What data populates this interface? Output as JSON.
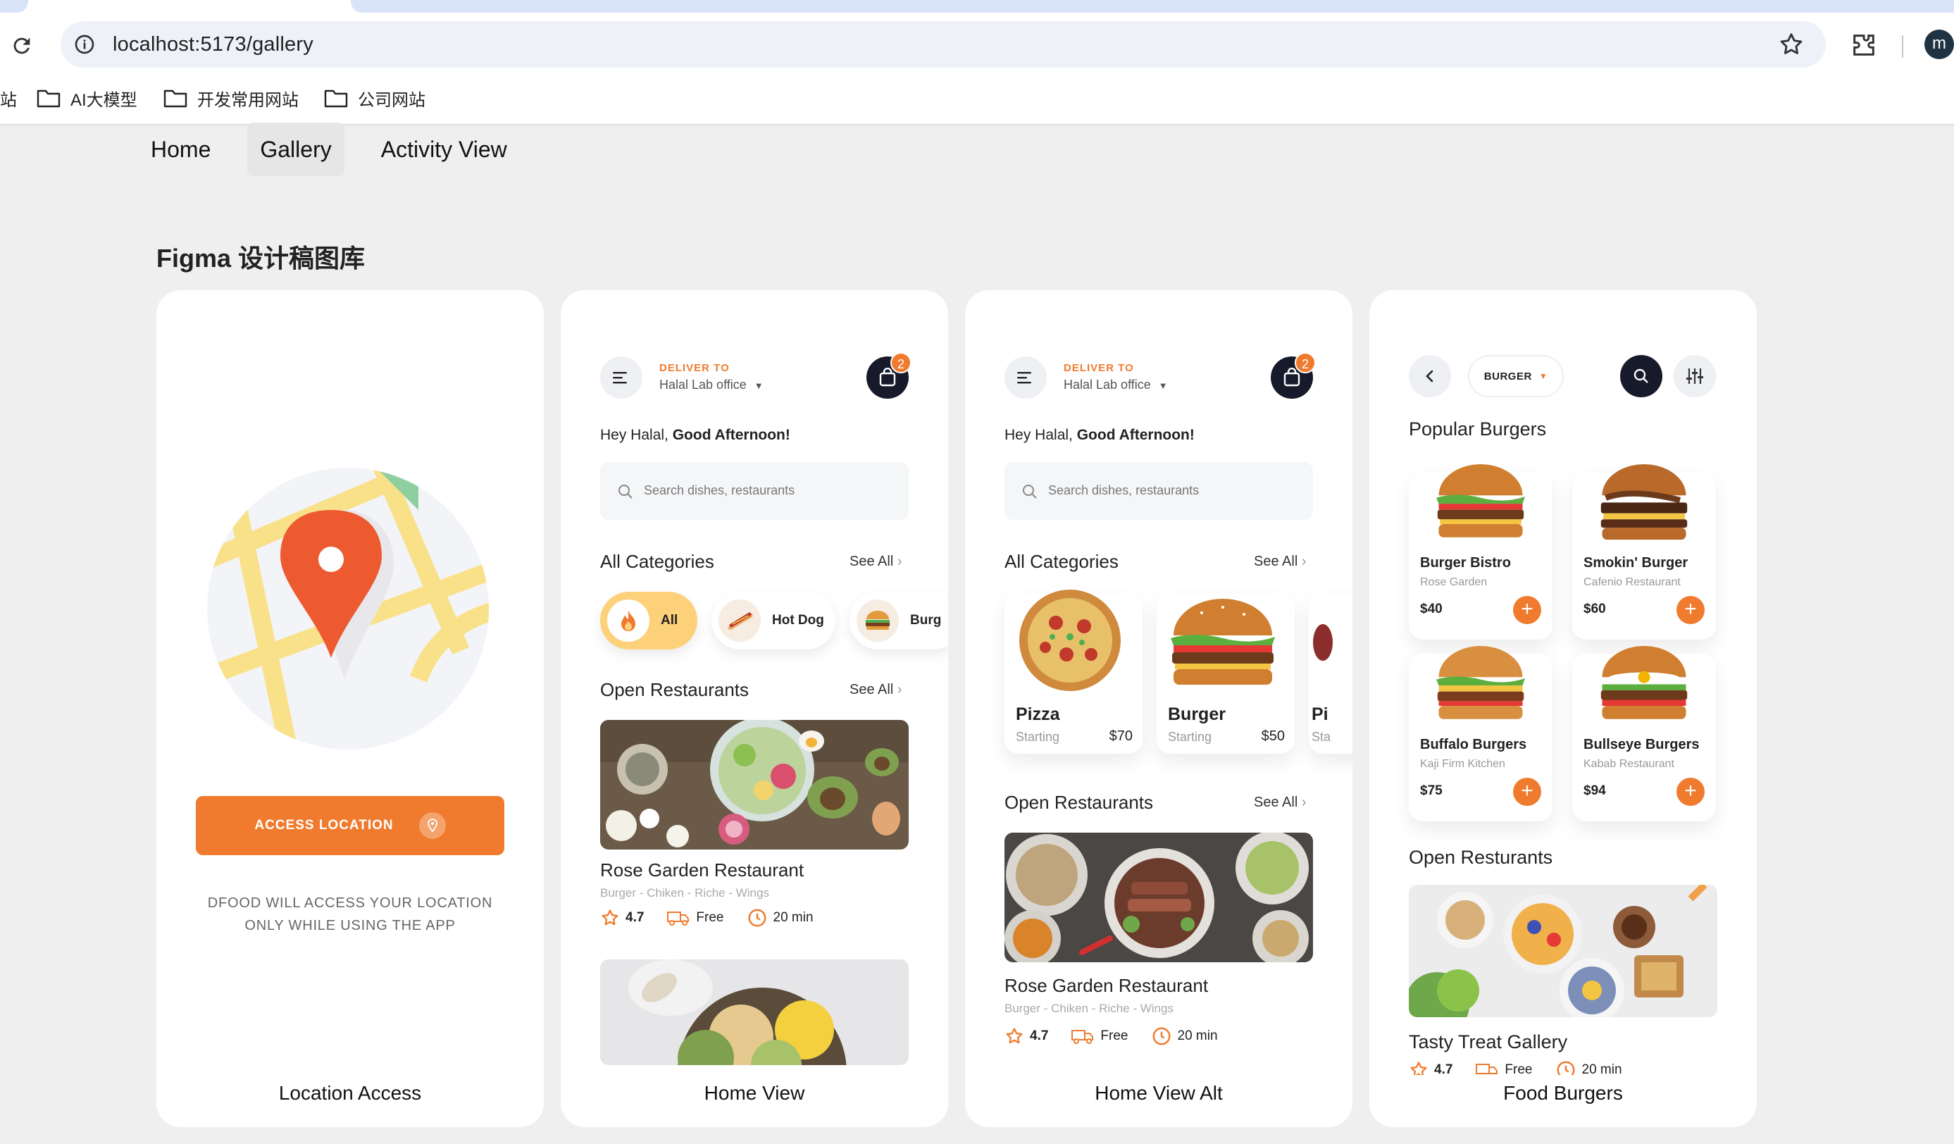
{
  "browser": {
    "url": "localhost:5173/gallery",
    "profile_initial": "m",
    "bookmarks": [
      "AI大模型",
      "开发常用网站",
      "公司网站"
    ],
    "bookmark_partial": "站"
  },
  "nav": {
    "items": [
      {
        "label": "Home",
        "active": false
      },
      {
        "label": "Gallery",
        "active": true
      },
      {
        "label": "Activity View",
        "active": false
      }
    ]
  },
  "page": {
    "title": "Figma 设计稿图库"
  },
  "cards": {
    "location": {
      "label": "Location Access",
      "button": "ACCESS LOCATION",
      "note_line1": "DFOOD WILL ACCESS YOUR LOCATION",
      "note_line2": "ONLY WHILE USING THE APP"
    },
    "home": {
      "label": "Home View",
      "deliver_to": "DELIVER TO",
      "office": "Halal Lab office",
      "cart_count": "2",
      "greet_plain": "Hey Halal, ",
      "greet_bold": "Good Afternoon!",
      "search_placeholder": "Search dishes, restaurants",
      "all_categories": "All Categories",
      "see_all": "See All",
      "chips": [
        "All",
        "Hot Dog",
        "Burg"
      ],
      "open_restaurants": "Open Restaurants",
      "restaurant_name": "Rose Garden Restaurant",
      "restaurant_tags": "Burger - Chiken - Riche - Wings",
      "rating": "4.7",
      "delivery": "Free",
      "time": "20 min"
    },
    "home_alt": {
      "label": "Home View Alt",
      "deliver_to": "DELIVER TO",
      "office": "Halal Lab office",
      "cart_count": "2",
      "greet_plain": "Hey Halal, ",
      "greet_bold": "Good Afternoon!",
      "search_placeholder": "Search dishes, restaurants",
      "all_categories": "All Categories",
      "see_all": "See All",
      "categories": [
        {
          "name": "Pizza",
          "starting": "Starting",
          "price": "$70"
        },
        {
          "name": "Burger",
          "starting": "Starting",
          "price": "$50"
        },
        {
          "name": "Pi",
          "starting": "Sta",
          "price": ""
        }
      ],
      "open_restaurants": "Open Restaurants",
      "restaurant_name": "Rose Garden Restaurant",
      "restaurant_tags": "Burger - Chiken - Riche - Wings",
      "rating": "4.7",
      "delivery": "Free",
      "time": "20 min"
    },
    "burgers": {
      "label": "Food Burgers",
      "filter": "BURGER",
      "popular": "Popular Burgers",
      "items": [
        {
          "name": "Burger Bistro",
          "place": "Rose Garden",
          "price": "$40"
        },
        {
          "name": "Smokin' Burger",
          "place": "Cafenio Restaurant",
          "price": "$60"
        },
        {
          "name": "Buffalo Burgers",
          "place": "Kaji Firm Kitchen",
          "price": "$75"
        },
        {
          "name": "Bullseye Burgers",
          "place": "Kabab Restaurant",
          "price": "$94"
        }
      ],
      "open_restaurants": "Open Resturants",
      "restaurant_name": "Tasty Treat Gallery",
      "rating": "4.7",
      "delivery": "Free",
      "time": "20 min"
    }
  },
  "colors": {
    "accent": "#f07b2e",
    "dark": "#171a2a",
    "page_bg": "#efefef"
  }
}
